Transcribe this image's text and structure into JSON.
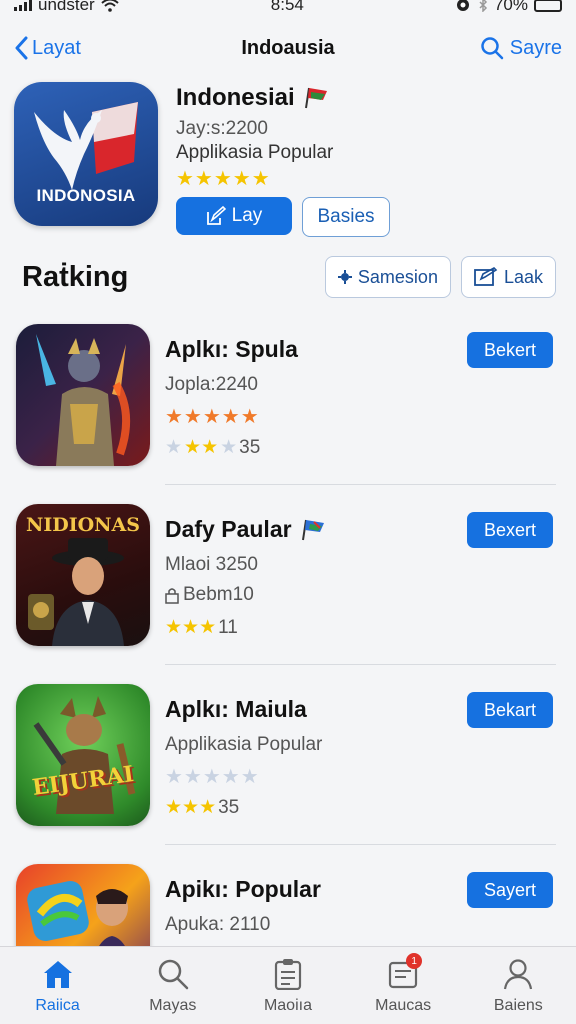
{
  "status_bar": {
    "carrier": "undster",
    "time": "8:54",
    "battery": "70%",
    "battery_level": 0.7
  },
  "nav": {
    "back_label": "Layat",
    "title": "Indoausia",
    "search_label": "Sayre"
  },
  "hero": {
    "title": "Indonesiai",
    "icon_label": "INDONOSIA",
    "line1": "Jay:s:2200",
    "line2": "Applikasia Popular",
    "rating_stars": "★★★★★",
    "primary_button": "Lay",
    "secondary_button": "Basies"
  },
  "section": {
    "title": "Raṫking",
    "action1": "Samesion",
    "action2": "Laak"
  },
  "apps": [
    {
      "title": "Aplkı: Spula",
      "line1": "Jopla:2240",
      "line2_stars": "★★★★★",
      "line3_stars_filled": "★★",
      "line3_stars_empty": "★",
      "line3_count": "35",
      "button": "Bekert"
    },
    {
      "title": "Dafy Paular",
      "icon_label": "NIDIONAS",
      "line1": "Mlaoi 3250",
      "line2": "Bebm10",
      "line3_stars_filled": "★★★",
      "line3_count": "11",
      "button": "Bexert"
    },
    {
      "title": "Aplkı: Maiula",
      "icon_label": "EIJURAI",
      "line1": "Applikasia Popular",
      "line2_stars": "★★★★★",
      "line3_stars_filled": "★★★",
      "line3_count": "35",
      "button": "Bekart"
    },
    {
      "title": "Apikı: Popular",
      "line1": "Apuka: 2110",
      "line2_stars": "★★★★★",
      "button": "Sayert"
    }
  ],
  "tabs": [
    {
      "label": "Raiica",
      "icon": "home-icon"
    },
    {
      "label": "Mayas",
      "icon": "search-icon"
    },
    {
      "label": "Maoiıa",
      "icon": "clipboard-icon"
    },
    {
      "label": "Maucas",
      "icon": "inbox-icon",
      "badge": "1"
    },
    {
      "label": "Baiens",
      "icon": "person-icon"
    }
  ]
}
